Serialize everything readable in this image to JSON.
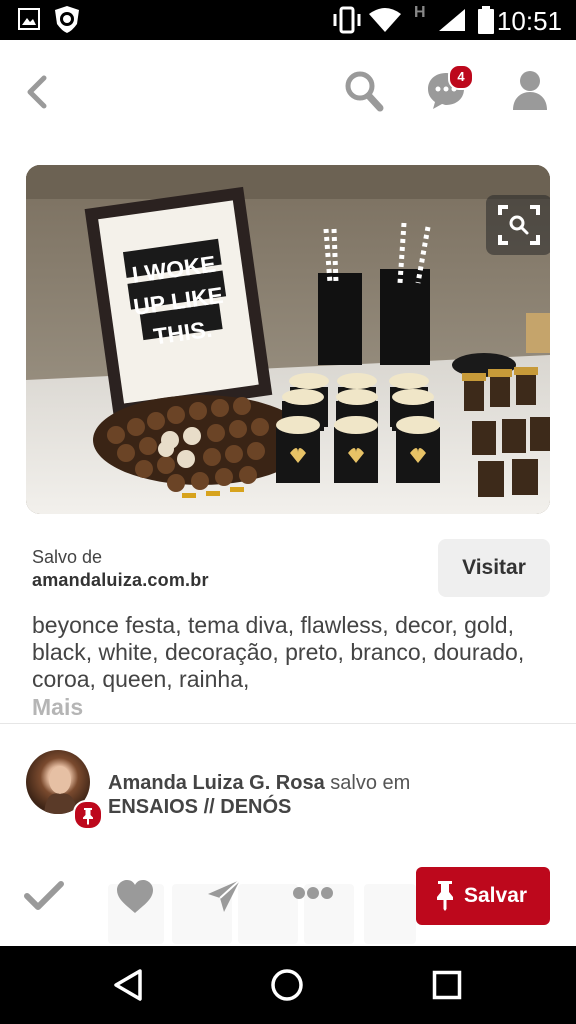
{
  "status_bar": {
    "time": "10:51",
    "network": "H"
  },
  "header": {
    "notifications_count": "4"
  },
  "pin_image": {
    "sign_text_line1": "I WOKE",
    "sign_text_line2": "UP LIKE",
    "sign_text_line3": "THIS."
  },
  "source": {
    "saved_label": "Salvo de",
    "domain": "amandaluiza.com.br",
    "visit_label": "Visitar"
  },
  "description": {
    "text": "beyonce festa, tema diva, flawless, decor, gold, black, white, decoração, preto, branco, dourado, coroa, queen, rainha,",
    "more_label": "Mais"
  },
  "saver": {
    "name": "Amanda Luiza G. Rosa",
    "connector": "salvo em",
    "board": "ENSAIOS // DENÓS"
  },
  "actions": {
    "save_label": "Salvar"
  },
  "colors": {
    "brand_red": "#bd081c",
    "icon_gray": "#9a9a9a"
  },
  "icons": [
    "back-icon",
    "search-icon",
    "messages-icon",
    "profile-icon",
    "visual-search-icon",
    "check-icon",
    "heart-icon",
    "send-icon",
    "more-icon",
    "pin-icon",
    "nav-back-icon",
    "nav-home-icon",
    "nav-recents-icon"
  ]
}
